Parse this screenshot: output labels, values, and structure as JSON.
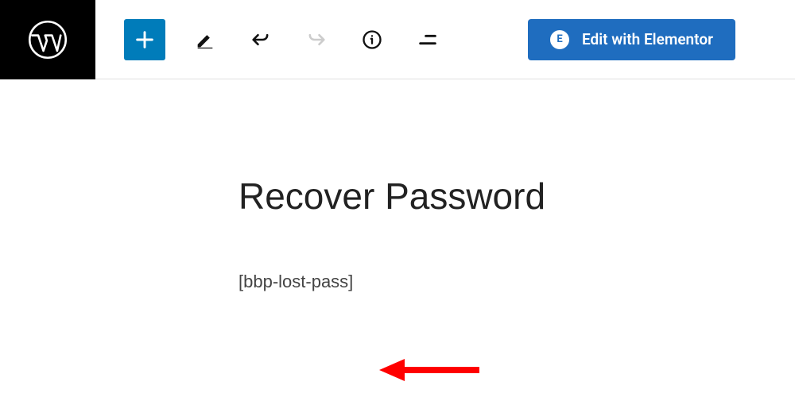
{
  "toolbar": {
    "elementor_label": "Edit with Elementor",
    "elementor_icon_text": "E"
  },
  "editor": {
    "page_title": "Recover Password",
    "shortcode": "[bbp-lost-pass]"
  }
}
